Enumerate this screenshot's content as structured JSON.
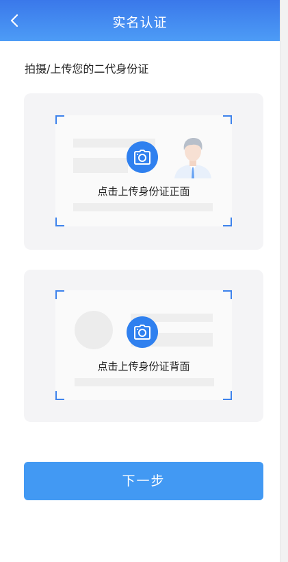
{
  "header": {
    "title": "实名认证",
    "back_icon": "chevron-left-icon",
    "gradient_from": "#3a78ea",
    "gradient_to": "#4d9cf6"
  },
  "instruction": "拍摄/上传您的二代身份证",
  "front_card": {
    "label": "点击上传身份证正面",
    "icon": "camera-icon"
  },
  "back_card": {
    "label": "点击上传身份证背面",
    "icon": "camera-icon"
  },
  "next_button": {
    "label": "下一步",
    "color": "#4299f3"
  },
  "accent_color": "#2f80ef"
}
